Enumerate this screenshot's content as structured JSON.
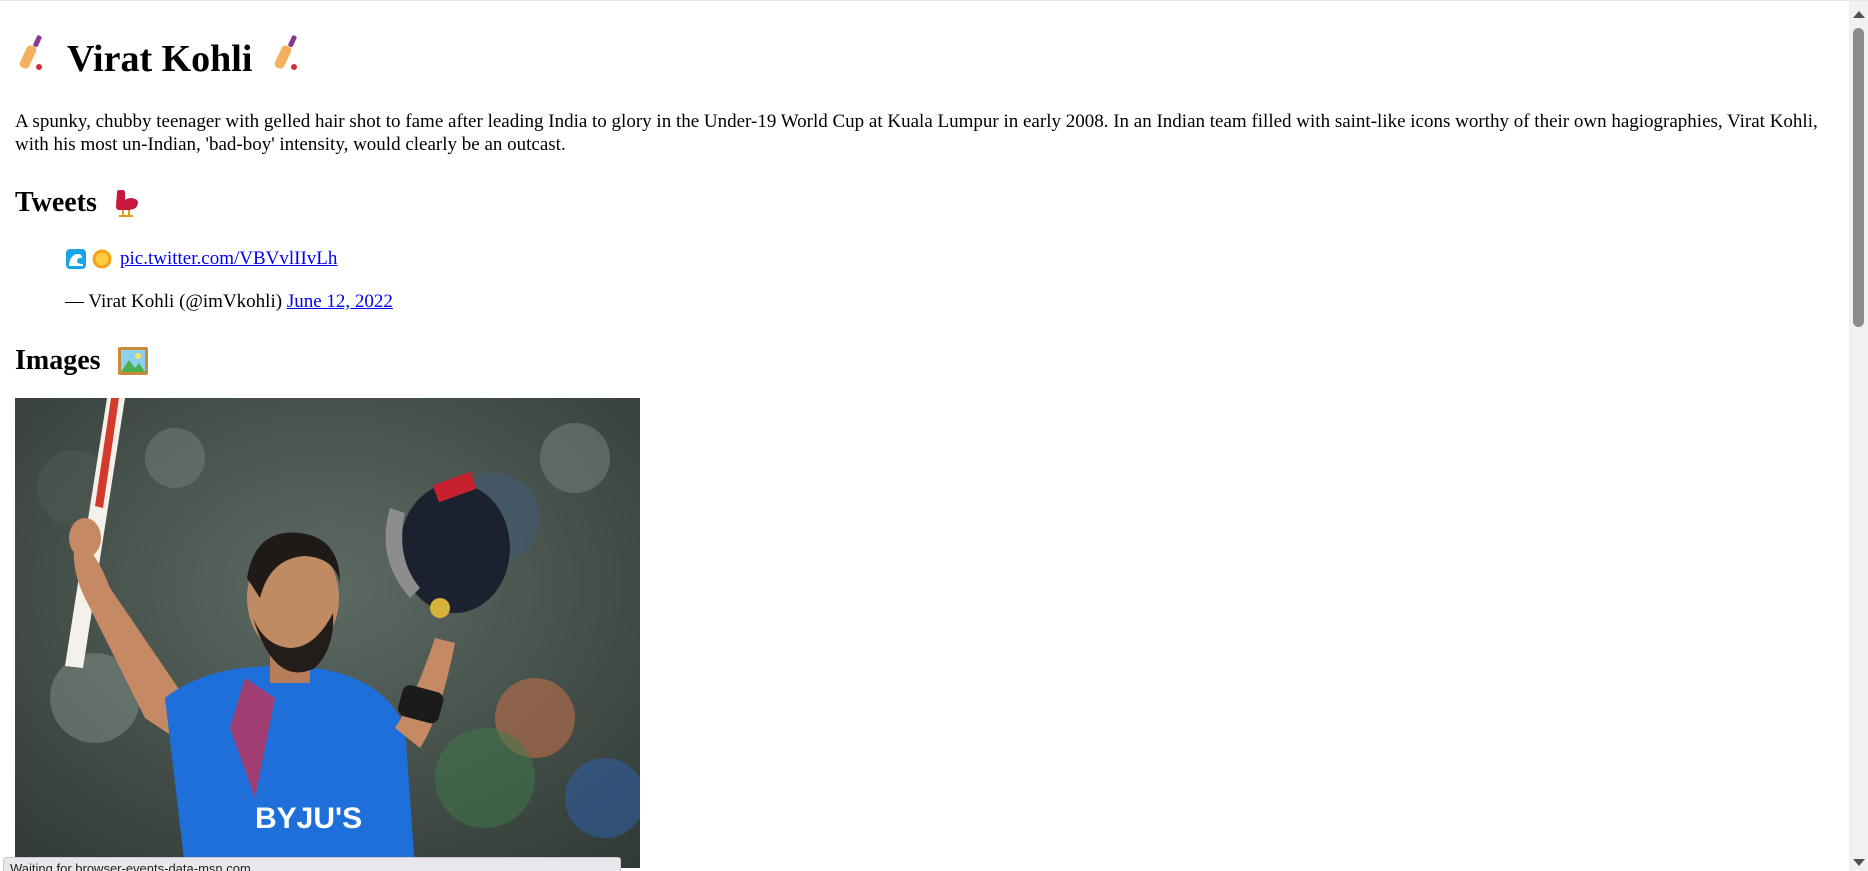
{
  "page": {
    "title": "Virat Kohli",
    "title_icon": "cricket-bat-icon",
    "intro": "A spunky, chubby teenager with gelled hair shot to fame after leading India to glory in the Under-19 World Cup at Kuala Lumpur in early 2008. In an Indian team filled with saint-like icons worthy of their own hagiographies, Virat Kohli, with his most un-Indian, 'bad-boy' intensity, would clearly be an outcast."
  },
  "tweets": {
    "heading": "Tweets",
    "heading_icon": "bird-icon",
    "items": [
      {
        "emojis": [
          "wave-icon",
          "sun-icon"
        ],
        "link_text": "pic.twitter.com/VBVvlIIvLh",
        "author": "— Virat Kohli (@imVkohli)",
        "date": "June 12, 2022"
      }
    ]
  },
  "images": {
    "heading": "Images",
    "heading_icon": "framed-picture-icon",
    "photo_alt": "Virat Kohli celebrating with bat raised and helmet in hand"
  },
  "status_bar": {
    "text": "Waiting for browser-events-data-msn.com..."
  },
  "colors": {
    "link": "#0000ee",
    "background": "#ffffff",
    "jersey_blue": "#1e6fd9"
  }
}
